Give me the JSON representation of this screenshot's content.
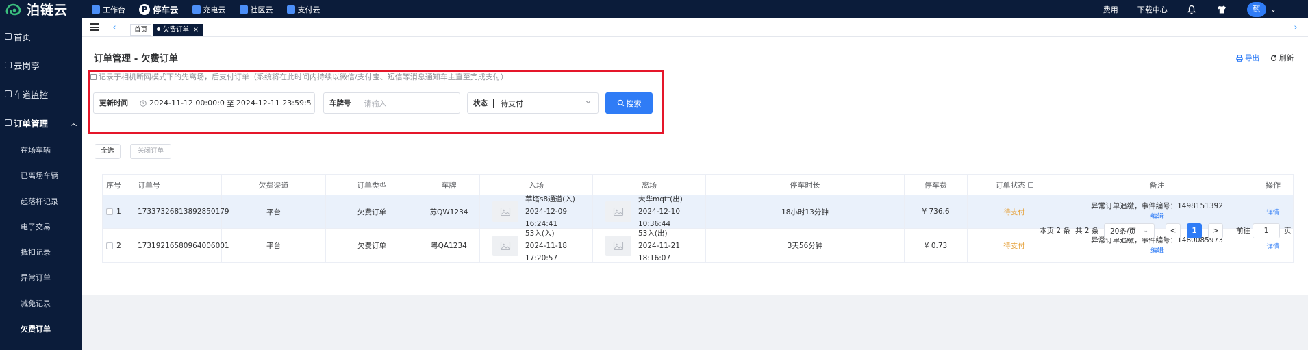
{
  "brand": {
    "name": "泊链云"
  },
  "topnav": [
    {
      "label": "工作台",
      "active": false
    },
    {
      "label": "停车云",
      "active": true,
      "mark": "P"
    },
    {
      "label": "充电云",
      "active": false
    },
    {
      "label": "社区云",
      "active": false
    },
    {
      "label": "支付云",
      "active": false
    }
  ],
  "topright": {
    "fees": "费用",
    "download": "下载中心",
    "avatar": "甄"
  },
  "sidebar": {
    "items": [
      {
        "label": "首页"
      },
      {
        "label": "云岗亭"
      },
      {
        "label": "车道监控"
      },
      {
        "label": "订单管理"
      }
    ],
    "subitems": [
      {
        "label": "在场车辆"
      },
      {
        "label": "已离场车辆"
      },
      {
        "label": "起落杆记录"
      },
      {
        "label": "电子交易"
      },
      {
        "label": "抵扣记录"
      },
      {
        "label": "异常订单"
      },
      {
        "label": "减免记录"
      },
      {
        "label": "欠费订单"
      }
    ]
  },
  "tabs": {
    "home": "首页",
    "current": "欠费订单",
    "close": "×"
  },
  "page": {
    "title": "订单管理 - 欠费订单",
    "export": "导出",
    "refresh": "刷新",
    "note": "记录于相机断网模式下的先离场，后支付订单（系统将在此时间内持续以微信/支付宝、短信等消息通知车主直至完成支付）"
  },
  "filters": {
    "time_label": "更新时间",
    "time_start": "2024-11-12 00:00:0",
    "time_sep": "至",
    "time_end": "2024-12-11 23:59:5",
    "plate_label": "车牌号",
    "plate_placeholder": "请输入",
    "status_label": "状态",
    "status_value": "待支付",
    "search": "搜索"
  },
  "actions": {
    "select_all": "全选",
    "close_order": "关闭订单"
  },
  "table": {
    "headers": {
      "index": "序号",
      "order_no": "订单号",
      "channel": "欠费渠道",
      "type": "订单类型",
      "plate": "车牌",
      "entry": "入场",
      "exit": "离场",
      "duration": "停车时长",
      "fee": "停车费",
      "status": "订单状态",
      "remark": "备注",
      "op": "操作"
    },
    "rows": [
      {
        "index": "1",
        "order_no": "17337326813892850179",
        "channel": "平台",
        "type": "欠费订单",
        "plate": "苏QW1234",
        "entry_gate": "苹塔s8通道(入)",
        "entry_time": "2024-12-09 16:24:41",
        "exit_gate": "大华mqtt(出)",
        "exit_time": "2024-12-10 10:36:44",
        "duration": "18小时13分钟",
        "fee": "¥ 736.6",
        "status": "待支付",
        "remark": "异常订单追缴，事件编号：1498151392",
        "edit": "编辑",
        "detail": "详情"
      },
      {
        "index": "2",
        "order_no": "17319216580964006001",
        "channel": "平台",
        "type": "欠费订单",
        "plate": "粤QA1234",
        "entry_gate": "53入(入)",
        "entry_time": "2024-11-18 17:20:57",
        "exit_gate": "53入(出)",
        "exit_time": "2024-11-21 18:16:07",
        "duration": "3天56分钟",
        "fee": "¥ 0.73",
        "status": "待支付",
        "remark": "异常订单追缴，事件编号：1480085973",
        "edit": "编辑",
        "detail": "详情"
      }
    ]
  },
  "pagination": {
    "page_count": "本页 2 条",
    "total": "共 2 条",
    "page_size": "20条/页",
    "prev": "<",
    "current": "1",
    "next": ">",
    "goto_label": "前往",
    "goto_value": "1",
    "page_unit": "页"
  },
  "colors": {
    "nav_bg": "#0b1c3a",
    "primary": "#2f7cf6",
    "warning": "#e6a23c",
    "highlight": "#e5162a"
  }
}
